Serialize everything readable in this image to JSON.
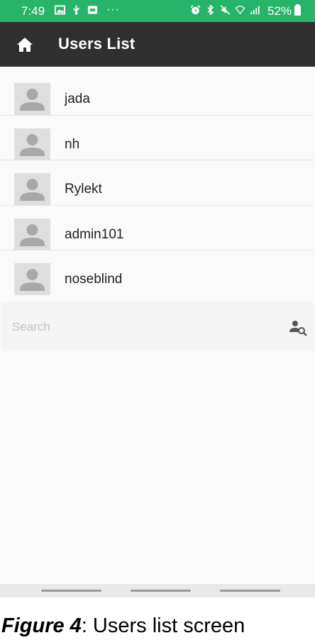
{
  "status_bar": {
    "time": "7:49",
    "battery": "52%",
    "background": "#27b46a",
    "left_icons": [
      "image-icon",
      "usb-icon",
      "app-icon"
    ],
    "right_icons": [
      "alarm-icon",
      "bluetooth-icon",
      "mute-icon",
      "wifi-icon",
      "signal-icon"
    ]
  },
  "app_bar": {
    "title": "Users List",
    "background": "#2f2f2f",
    "home_icon": "home-icon"
  },
  "users": [
    {
      "name": "jada"
    },
    {
      "name": "nh"
    },
    {
      "name": "Rylekt"
    },
    {
      "name": "admin101"
    },
    {
      "name": "noseblind"
    }
  ],
  "search": {
    "placeholder": "Search",
    "value": "",
    "icon": "user-search-icon"
  },
  "caption": {
    "figure_label": "Figure 4",
    "text": ": Users list screen"
  }
}
